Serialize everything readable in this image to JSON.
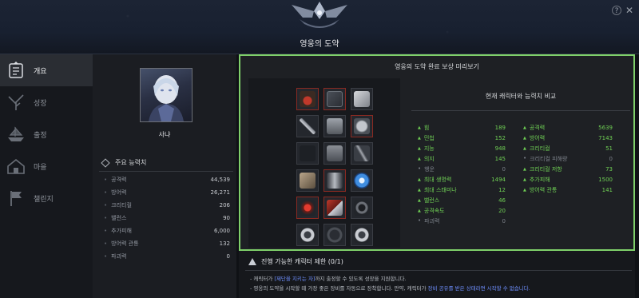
{
  "header": {
    "title": "영웅의 도약"
  },
  "sidebar": {
    "items": [
      {
        "label": "개요",
        "icon": "overview-icon",
        "active": true
      },
      {
        "label": "성장",
        "icon": "tree-icon",
        "active": false
      },
      {
        "label": "출정",
        "icon": "ship-icon",
        "active": false
      },
      {
        "label": "마을",
        "icon": "village-icon",
        "active": false
      },
      {
        "label": "챌린지",
        "icon": "flag-icon",
        "active": false
      }
    ]
  },
  "character": {
    "name": "사냐",
    "stats_title": "주요 능력치",
    "stats": [
      {
        "label": "공격력",
        "value": "44,539"
      },
      {
        "label": "방어력",
        "value": "26,271"
      },
      {
        "label": "크리티컬",
        "value": "206"
      },
      {
        "label": "밸런스",
        "value": "90"
      },
      {
        "label": "추가피해",
        "value": "6,000"
      },
      {
        "label": "방어력 관통",
        "value": "132"
      },
      {
        "label": "파괴력",
        "value": "0"
      }
    ]
  },
  "preview": {
    "title": "영웅의 도약 완료 보상 미리보기",
    "compare_title": "현재 캐릭터와 능력치 비교",
    "left_stats": [
      {
        "label": "힘",
        "value": "189",
        "up": true
      },
      {
        "label": "민첩",
        "value": "152",
        "up": true
      },
      {
        "label": "지능",
        "value": "948",
        "up": true
      },
      {
        "label": "의지",
        "value": "145",
        "up": true
      },
      {
        "label": "행운",
        "value": "0",
        "up": false
      },
      {
        "label": "최대 생명력",
        "value": "1494",
        "up": true
      },
      {
        "label": "최대 스태미나",
        "value": "12",
        "up": true
      },
      {
        "label": "밸런스",
        "value": "46",
        "up": true
      },
      {
        "label": "공격속도",
        "value": "20",
        "up": true
      },
      {
        "label": "파괴력",
        "value": "0",
        "up": false
      }
    ],
    "right_stats": [
      {
        "label": "공격력",
        "value": "5639",
        "up": true
      },
      {
        "label": "방어력",
        "value": "7143",
        "up": true
      },
      {
        "label": "크리티컬",
        "value": "51",
        "up": true
      },
      {
        "label": "크리티컬 피해량",
        "value": "0",
        "up": false
      },
      {
        "label": "크리티컬 저항",
        "value": "73",
        "up": true
      },
      {
        "label": "추가피해",
        "value": "1500",
        "up": true
      },
      {
        "label": "방어력 관통",
        "value": "141",
        "up": true
      }
    ]
  },
  "notice": {
    "title": "진행 가능한 캐릭터 제한 (0/1)",
    "line1_pre": "- 캐릭터가 ",
    "line1_hl": "[제단을 지키는 자]",
    "line1_post": "까지 출정할 수 있도록 성장을 지원합니다.",
    "line2_pre": "- 영웅의 도약을 시작할 때 가장 좋은 장비를 자동으로 장착합니다. 만약, 캐릭터가 ",
    "line2_hl": "장비 공유를 받은 상태라면 시작할 수 없습니다."
  },
  "colors": {
    "accent_green": "#7fd06a",
    "stat_up": "#6fcf54",
    "link_blue": "#6f8fff"
  }
}
